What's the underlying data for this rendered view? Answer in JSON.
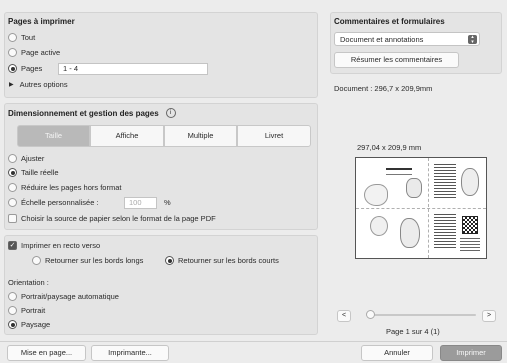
{
  "pages": {
    "title": "Pages à imprimer",
    "all": "Tout",
    "active": "Page active",
    "pages_label": "Pages",
    "pages_value": "1 - 4",
    "more": "Autres options"
  },
  "sizing": {
    "title": "Dimensionnement et gestion des pages",
    "info_icon": "i",
    "tabs": [
      "Taille",
      "Affiche",
      "Multiple",
      "Livret"
    ],
    "fit": "Ajuster",
    "actual": "Taille réelle",
    "shrink": "Réduire les pages hors format",
    "custom": "Échelle personnalisée :",
    "custom_value": "100",
    "percent": "%",
    "paper_source": "Choisir la source de papier selon le format de la page PDF"
  },
  "duplex": {
    "label": "Imprimer en recto verso",
    "long": "Retourner sur les bords longs",
    "short": "Retourner sur les bords courts"
  },
  "orientation": {
    "title": "Orientation :",
    "auto": "Portrait/paysage automatique",
    "portrait": "Portrait",
    "landscape": "Paysage"
  },
  "comments": {
    "title": "Commentaires et formulaires",
    "select_value": "Document et annotations",
    "summarize": "Résumer les commentaires"
  },
  "preview": {
    "doc_size": "Document : 296,7 x 209,9mm",
    "page_size": "297,04 x 209,9 mm",
    "prev": "<",
    "next": ">",
    "page_indicator": "Page 1 sur 4 (1)"
  },
  "footer": {
    "page_setup": "Mise en page...",
    "printer": "Imprimante...",
    "cancel": "Annuler",
    "print": "Imprimer"
  }
}
